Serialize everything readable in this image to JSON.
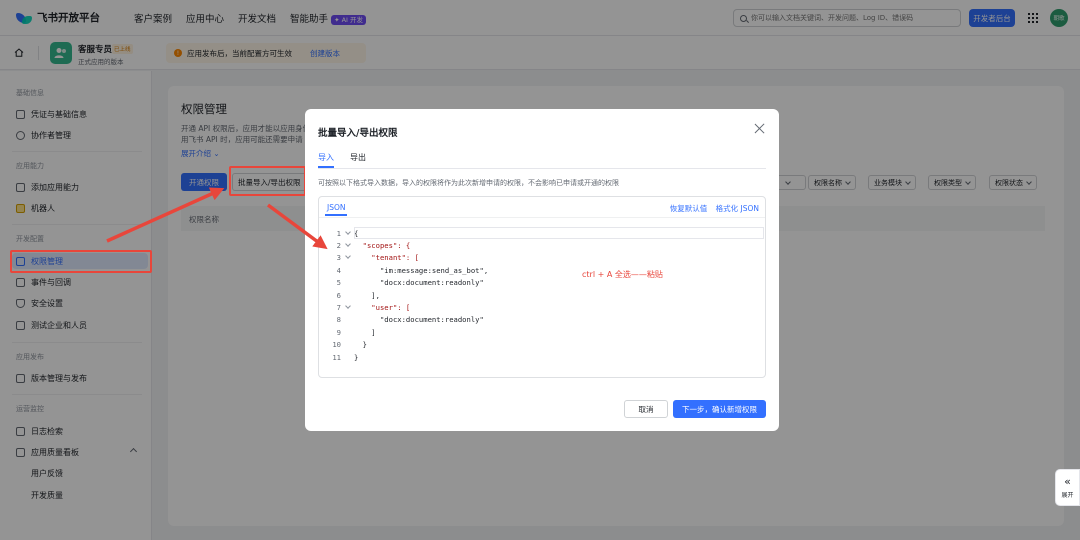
{
  "topnav": {
    "brand": "飞书开放平台",
    "items": [
      "客户案例",
      "应用中心",
      "开发文档",
      "智能助手"
    ],
    "ai_badge": "✦ AI 开发",
    "search_placeholder": "你可以输入文档关键词、开发问题、Log ID、错误码",
    "dev_console": "开发者后台",
    "avatar_text": "朝歌"
  },
  "app": {
    "name": "客服专员",
    "status": "已上线",
    "subtitle": "正式应用的版本",
    "notice": "应用发布后，当前配置方可生效",
    "notice_link": "创建版本"
  },
  "sidebar": {
    "groups": [
      "基础信息",
      "应用能力",
      "开发配置",
      "应用发布",
      "运营监控"
    ],
    "items": [
      "凭证与基础信息",
      "协作者管理",
      "添加应用能力",
      "机器人",
      "权限管理",
      "事件与回调",
      "安全设置",
      "测试企业和人员",
      "版本管理与发布",
      "日志检索",
      "应用质量看板"
    ],
    "sub_items": [
      "用户反馈",
      "开发质量"
    ]
  },
  "main": {
    "title": "权限管理",
    "desc": "开通 API 权限后，应用才能以应用身份 用飞书 API 时，应用可能还需要申请",
    "expand": "展开介绍",
    "open_btn": "开通权限",
    "batch_btn": "批量导入/导出权限",
    "table_col": "权限名称",
    "filters": [
      "权限名称",
      "业务模块",
      "权限类型",
      "权限状态"
    ]
  },
  "modal": {
    "title": "批量导入/导出权限",
    "tabs": [
      "导入",
      "导出"
    ],
    "desc": "可按照以下格式导入数据，导入的权限将作为此次新增申请的权限，不会影响已申请或开通的权限",
    "editor_tab": "JSON",
    "restore": "恢复默认值",
    "format": "格式化 JSON",
    "code_lines": [
      "{",
      "  \"scopes\": {",
      "    \"tenant\": [",
      "      \"im:message:send_as_bot\",",
      "      \"docx:document:readonly\"",
      "    ],",
      "    \"user\": [",
      "      \"docx:document:readonly\"",
      "    ]",
      "  }",
      "}"
    ],
    "annotation": "ctrl + A 全选——粘贴",
    "cancel": "取消",
    "next": "下一步，确认新增权限"
  },
  "side_expand": {
    "icon": "«",
    "label": "展开"
  },
  "colors": {
    "accent": "#3370ff",
    "annotation_red": "#e8463b"
  }
}
